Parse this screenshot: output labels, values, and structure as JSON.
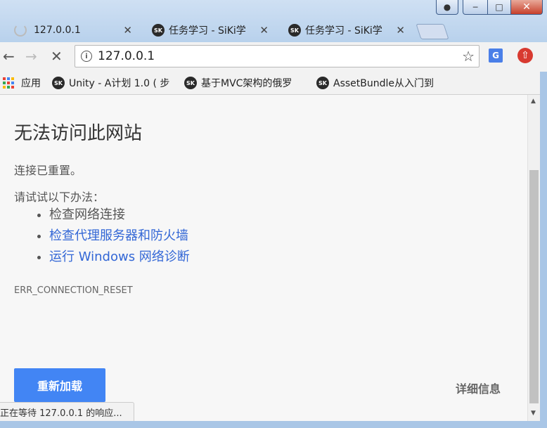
{
  "tabs": [
    {
      "title": "127.0.0.1",
      "active": true
    },
    {
      "title": "任务学习 - SiKi学",
      "icon_text": "SK"
    },
    {
      "title": "任务学习 - SiKi学",
      "icon_text": "SK"
    }
  ],
  "toolbar": {
    "url": "127.0.0.1",
    "translate_icon_text": "G"
  },
  "bookmarks": [
    {
      "label": "应用"
    },
    {
      "label": "Unity - A计划 1.0 ( 步",
      "icon_text": "SK"
    },
    {
      "label": "基于MVC架构的俄罗",
      "icon_text": "SK"
    },
    {
      "label": "AssetBundle从入门到",
      "icon_text": "SK"
    }
  ],
  "error": {
    "title": "无法访问此网站",
    "subtitle": "连接已重置。",
    "suggest_heading": "请试试以下办法：",
    "suggestions": [
      "检查网络连接",
      "检查代理服务器和防火墙",
      "运行 Windows 网络诊断"
    ],
    "code": "ERR_CONNECTION_RESET",
    "reload_label": "重新加载",
    "details_label": "详细信息"
  },
  "status_text": "正在等待 127.0.0.1 的响应...",
  "icons": {
    "spinner": "loading-spinner-icon",
    "star": "star-icon",
    "upgrade": "upgrade-arrow-icon"
  },
  "colors": {
    "accent": "#4285f4",
    "link": "#3367d6",
    "upgrade": "#d83a30"
  }
}
